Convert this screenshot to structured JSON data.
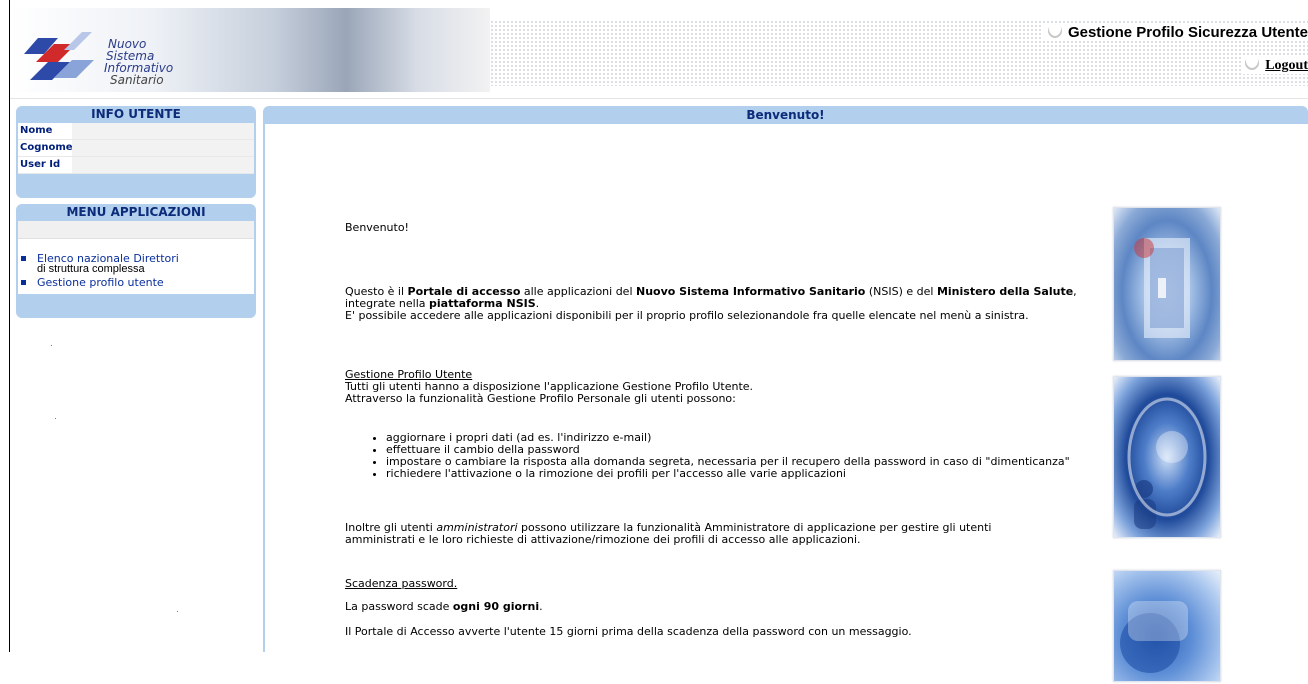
{
  "header": {
    "logo_lines": [
      "Nuovo",
      "Sistema",
      "Informativo",
      "Sanitario"
    ],
    "title": "Gestione Profilo Sicurezza Utente",
    "logout_label": "Logout"
  },
  "info_panel": {
    "title": "INFO UTENTE",
    "rows": [
      {
        "label": "Nome",
        "value": ""
      },
      {
        "label": "Cognome",
        "value": ""
      },
      {
        "label": "User Id",
        "value": ""
      }
    ]
  },
  "menu_panel": {
    "title": "MENU APPLICAZIONI",
    "items": [
      {
        "label": "Elenco nazionale Direttori",
        "sub": "di struttura complessa"
      },
      {
        "label": "Gestione profilo utente",
        "sub": ""
      }
    ]
  },
  "main": {
    "title": "Benvenuto!",
    "greeting": "Benvenuto!",
    "intro": {
      "t1": "Questo è il ",
      "b1": "Portale di accesso",
      "t2": " alle applicazioni del ",
      "b2": "Nuovo Sistema Informativo Sanitario",
      "t3": " (NSIS) e del ",
      "b3": "Ministero della Salute",
      "t4": ", integrate nella ",
      "b4": "piattaforma NSIS",
      "t5": ".",
      "line2": "E' possibile accedere alle applicazioni disponibili per il proprio profilo selezionandole fra quelle elencate nel menù a sinistra."
    },
    "gestione": {
      "heading": "Gestione Profilo Utente",
      "line1": "Tutti gli utenti hanno a disposizione l'applicazione Gestione Profilo Utente.",
      "line2": "Attraverso la funzionalità Gestione Profilo Personale gli utenti possono:",
      "bullets": [
        "aggiornare i propri dati (ad es. l'indirizzo e-mail)",
        "effettuare il cambio della password",
        "impostare o cambiare la risposta alla domanda segreta, necessaria per il recupero della password in caso di \"dimenticanza\"",
        "richiedere l'attivazione o la rimozione dei profili per l'accesso alle varie applicazioni"
      ],
      "admin_t1": "Inoltre gli utenti ",
      "admin_em": "amministratori",
      "admin_t2": " possono utilizzare la funzionalità Amministratore di applicazione per gestire gli utenti amministrati e le loro richieste di attivazione/rimozione dei profili di accesso alle applicazioni."
    },
    "scadenza": {
      "heading": "Scadenza password.",
      "line1_t": "La password scade ",
      "line1_b": "ogni 90 giorni",
      "line1_end": ".",
      "line2": "Il Portale di Accesso avverte l'utente 15 giorni prima della scadenza della password con un messaggio."
    }
  }
}
